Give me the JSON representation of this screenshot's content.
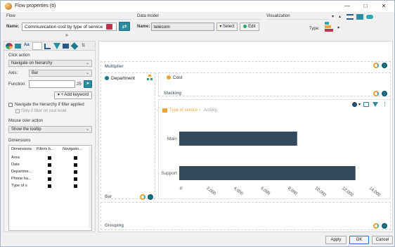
{
  "window": {
    "title": "Flow properties (tt)"
  },
  "flow": {
    "section_label": "Flow",
    "name_label": "Name:",
    "name_value": "Communication cost by type of service"
  },
  "data_model": {
    "section_label": "Data model",
    "name_label": "Name:",
    "name_value": "telecom",
    "select_label": "Select",
    "edit_label": "Edit"
  },
  "visualization": {
    "section_label": "Visualization",
    "type_label": "Type:"
  },
  "click_action": {
    "section_label": "Click action",
    "action_value": "Navigate on hierarchy",
    "axis_label": "Axis:",
    "axis_value": "Bar",
    "function_label": "Function:",
    "function_value": "",
    "function_count": "25",
    "add_keyword_label": "Add keyword",
    "nav_if_filter_label": "Navigate the hierarchy if filter applied",
    "only_root_label": "Only if filter on root level"
  },
  "mouse_over": {
    "section_label": "Mouse over action",
    "value": "Show the tooltip"
  },
  "dimensions": {
    "section_label": "Dimensions",
    "headers": [
      "Dimensions",
      "Filters b...",
      "Navigatio..."
    ],
    "rows": [
      "Area",
      "Date",
      "Departme...",
      "Phone ha...",
      "Type of s"
    ]
  },
  "zones": {
    "multiplier": "Multiplier",
    "department": "Department",
    "cost": "Cost",
    "stacking": "Stacking",
    "bar": "Bar",
    "grouping": "Grouping"
  },
  "breadcrumb": {
    "current": "Type of service",
    "next": "Activity"
  },
  "footer": {
    "apply": "Apply",
    "ok": "OK",
    "cancel": "Cancel"
  },
  "colors": {
    "bar": "#34495e",
    "accent": "#1c7a8c",
    "orange": "#f0a430"
  },
  "chart_data": {
    "type": "bar",
    "orientation": "horizontal",
    "categories": [
      "Main",
      "Support"
    ],
    "values": [
      8700,
      13000
    ],
    "xlim": [
      0,
      14000
    ],
    "xticks": [
      "0",
      "2,000",
      "4,000",
      "6,000",
      "8,000",
      "10,000",
      "12,000",
      "14,000"
    ]
  }
}
